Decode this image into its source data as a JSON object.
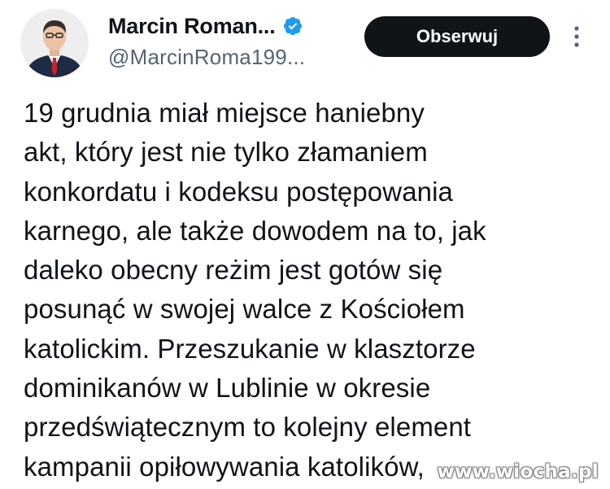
{
  "author": {
    "display_name": "Marcin Roman...",
    "handle": "@MarcinRoma199...",
    "verified": true,
    "avatar_icon": "profile-photo"
  },
  "actions": {
    "follow_label": "Obserwuj",
    "more_icon": "more-vertical-icon"
  },
  "tweet": {
    "lines": [
      "19 grudnia miał miejsce haniebny",
      "akt, który jest nie tylko złamaniem",
      "konkordatu i kodeksu postępowania",
      "karnego, ale także dowodem na to, jak",
      "daleko obecny reżim jest gotów się",
      "posunąć w swojej walce z Kościołem",
      "katolickim. Przeszukanie w klasztorze",
      "dominikanów w Lublinie w okresie",
      "przedświątecznym to kolejny element",
      "kampanii opiłowywania katolików,"
    ]
  },
  "watermark": "www.wiocha.pl",
  "colors": {
    "text": "#0f1419",
    "secondary_text": "#536471",
    "button_bg": "#0f1419",
    "verified_blue": "#1d9bf0"
  }
}
